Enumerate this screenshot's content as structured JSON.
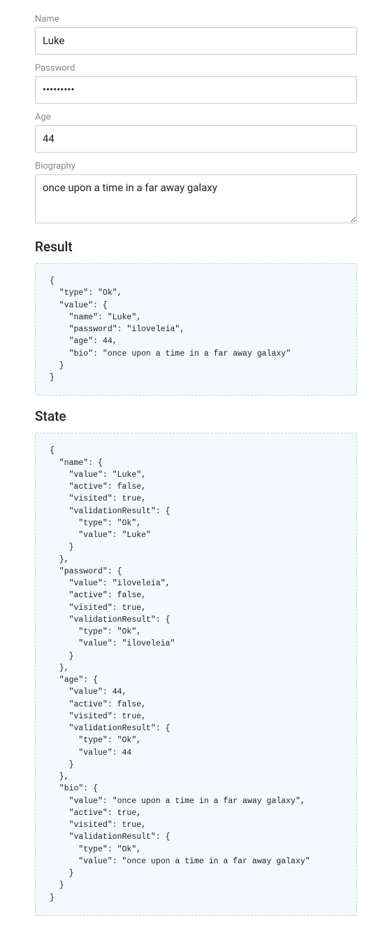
{
  "form": {
    "name": {
      "label": "Name",
      "value": "Luke"
    },
    "password": {
      "label": "Password",
      "value": "•••••••••"
    },
    "age": {
      "label": "Age",
      "value": "44"
    },
    "biography": {
      "label": "Biography",
      "value": "once upon a time in a far away galaxy"
    }
  },
  "sections": {
    "result": {
      "heading": "Result",
      "code": "{\n  \"type\": \"Ok\",\n  \"value\": {\n    \"name\": \"Luke\",\n    \"password\": \"iloveleia\",\n    \"age\": 44,\n    \"bio\": \"once upon a time in a far away galaxy\"\n  }\n}"
    },
    "state": {
      "heading": "State",
      "code": "{\n  \"name\": {\n    \"value\": \"Luke\",\n    \"active\": false,\n    \"visited\": true,\n    \"validationResult\": {\n      \"type\": \"Ok\",\n      \"value\": \"Luke\"\n    }\n  },\n  \"password\": {\n    \"value\": \"iloveleia\",\n    \"active\": false,\n    \"visited\": true,\n    \"validationResult\": {\n      \"type\": \"Ok\",\n      \"value\": \"iloveleia\"\n    }\n  },\n  \"age\": {\n    \"value\": 44,\n    \"active\": false,\n    \"visited\": true,\n    \"validationResult\": {\n      \"type\": \"Ok\",\n      \"value\": 44\n    }\n  },\n  \"bio\": {\n    \"value\": \"once upon a time in a far away galaxy\",\n    \"active\": true,\n    \"visited\": true,\n    \"validationResult\": {\n      \"type\": \"Ok\",\n      \"value\": \"once upon a time in a far away galaxy\"\n    }\n  }\n}"
    }
  }
}
